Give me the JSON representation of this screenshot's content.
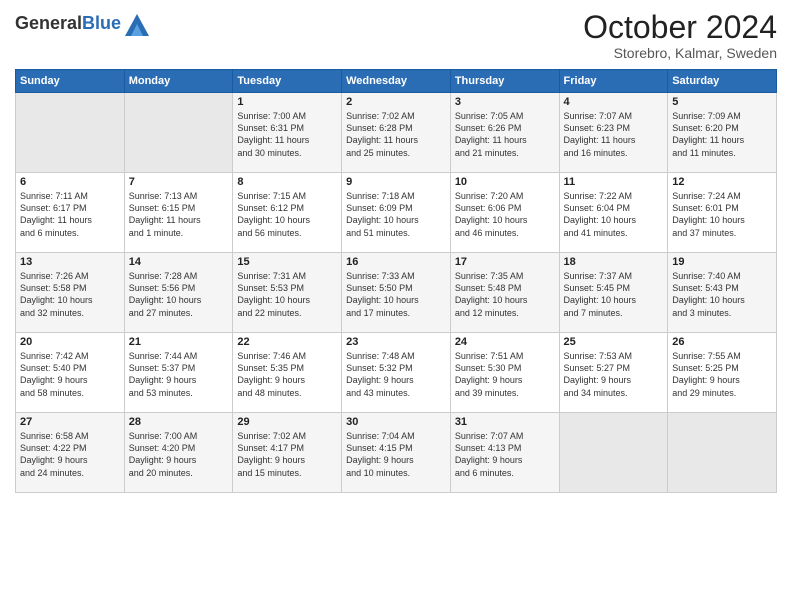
{
  "header": {
    "logo_line1": "General",
    "logo_line2": "Blue",
    "title": "October 2024",
    "subtitle": "Storebro, Kalmar, Sweden"
  },
  "days_of_week": [
    "Sunday",
    "Monday",
    "Tuesday",
    "Wednesday",
    "Thursday",
    "Friday",
    "Saturday"
  ],
  "weeks": [
    [
      {
        "day": "",
        "info": ""
      },
      {
        "day": "",
        "info": ""
      },
      {
        "day": "1",
        "info": "Sunrise: 7:00 AM\nSunset: 6:31 PM\nDaylight: 11 hours\nand 30 minutes."
      },
      {
        "day": "2",
        "info": "Sunrise: 7:02 AM\nSunset: 6:28 PM\nDaylight: 11 hours\nand 25 minutes."
      },
      {
        "day": "3",
        "info": "Sunrise: 7:05 AM\nSunset: 6:26 PM\nDaylight: 11 hours\nand 21 minutes."
      },
      {
        "day": "4",
        "info": "Sunrise: 7:07 AM\nSunset: 6:23 PM\nDaylight: 11 hours\nand 16 minutes."
      },
      {
        "day": "5",
        "info": "Sunrise: 7:09 AM\nSunset: 6:20 PM\nDaylight: 11 hours\nand 11 minutes."
      }
    ],
    [
      {
        "day": "6",
        "info": "Sunrise: 7:11 AM\nSunset: 6:17 PM\nDaylight: 11 hours\nand 6 minutes."
      },
      {
        "day": "7",
        "info": "Sunrise: 7:13 AM\nSunset: 6:15 PM\nDaylight: 11 hours\nand 1 minute."
      },
      {
        "day": "8",
        "info": "Sunrise: 7:15 AM\nSunset: 6:12 PM\nDaylight: 10 hours\nand 56 minutes."
      },
      {
        "day": "9",
        "info": "Sunrise: 7:18 AM\nSunset: 6:09 PM\nDaylight: 10 hours\nand 51 minutes."
      },
      {
        "day": "10",
        "info": "Sunrise: 7:20 AM\nSunset: 6:06 PM\nDaylight: 10 hours\nand 46 minutes."
      },
      {
        "day": "11",
        "info": "Sunrise: 7:22 AM\nSunset: 6:04 PM\nDaylight: 10 hours\nand 41 minutes."
      },
      {
        "day": "12",
        "info": "Sunrise: 7:24 AM\nSunset: 6:01 PM\nDaylight: 10 hours\nand 37 minutes."
      }
    ],
    [
      {
        "day": "13",
        "info": "Sunrise: 7:26 AM\nSunset: 5:58 PM\nDaylight: 10 hours\nand 32 minutes."
      },
      {
        "day": "14",
        "info": "Sunrise: 7:28 AM\nSunset: 5:56 PM\nDaylight: 10 hours\nand 27 minutes."
      },
      {
        "day": "15",
        "info": "Sunrise: 7:31 AM\nSunset: 5:53 PM\nDaylight: 10 hours\nand 22 minutes."
      },
      {
        "day": "16",
        "info": "Sunrise: 7:33 AM\nSunset: 5:50 PM\nDaylight: 10 hours\nand 17 minutes."
      },
      {
        "day": "17",
        "info": "Sunrise: 7:35 AM\nSunset: 5:48 PM\nDaylight: 10 hours\nand 12 minutes."
      },
      {
        "day": "18",
        "info": "Sunrise: 7:37 AM\nSunset: 5:45 PM\nDaylight: 10 hours\nand 7 minutes."
      },
      {
        "day": "19",
        "info": "Sunrise: 7:40 AM\nSunset: 5:43 PM\nDaylight: 10 hours\nand 3 minutes."
      }
    ],
    [
      {
        "day": "20",
        "info": "Sunrise: 7:42 AM\nSunset: 5:40 PM\nDaylight: 9 hours\nand 58 minutes."
      },
      {
        "day": "21",
        "info": "Sunrise: 7:44 AM\nSunset: 5:37 PM\nDaylight: 9 hours\nand 53 minutes."
      },
      {
        "day": "22",
        "info": "Sunrise: 7:46 AM\nSunset: 5:35 PM\nDaylight: 9 hours\nand 48 minutes."
      },
      {
        "day": "23",
        "info": "Sunrise: 7:48 AM\nSunset: 5:32 PM\nDaylight: 9 hours\nand 43 minutes."
      },
      {
        "day": "24",
        "info": "Sunrise: 7:51 AM\nSunset: 5:30 PM\nDaylight: 9 hours\nand 39 minutes."
      },
      {
        "day": "25",
        "info": "Sunrise: 7:53 AM\nSunset: 5:27 PM\nDaylight: 9 hours\nand 34 minutes."
      },
      {
        "day": "26",
        "info": "Sunrise: 7:55 AM\nSunset: 5:25 PM\nDaylight: 9 hours\nand 29 minutes."
      }
    ],
    [
      {
        "day": "27",
        "info": "Sunrise: 6:58 AM\nSunset: 4:22 PM\nDaylight: 9 hours\nand 24 minutes."
      },
      {
        "day": "28",
        "info": "Sunrise: 7:00 AM\nSunset: 4:20 PM\nDaylight: 9 hours\nand 20 minutes."
      },
      {
        "day": "29",
        "info": "Sunrise: 7:02 AM\nSunset: 4:17 PM\nDaylight: 9 hours\nand 15 minutes."
      },
      {
        "day": "30",
        "info": "Sunrise: 7:04 AM\nSunset: 4:15 PM\nDaylight: 9 hours\nand 10 minutes."
      },
      {
        "day": "31",
        "info": "Sunrise: 7:07 AM\nSunset: 4:13 PM\nDaylight: 9 hours\nand 6 minutes."
      },
      {
        "day": "",
        "info": ""
      },
      {
        "day": "",
        "info": ""
      }
    ]
  ]
}
